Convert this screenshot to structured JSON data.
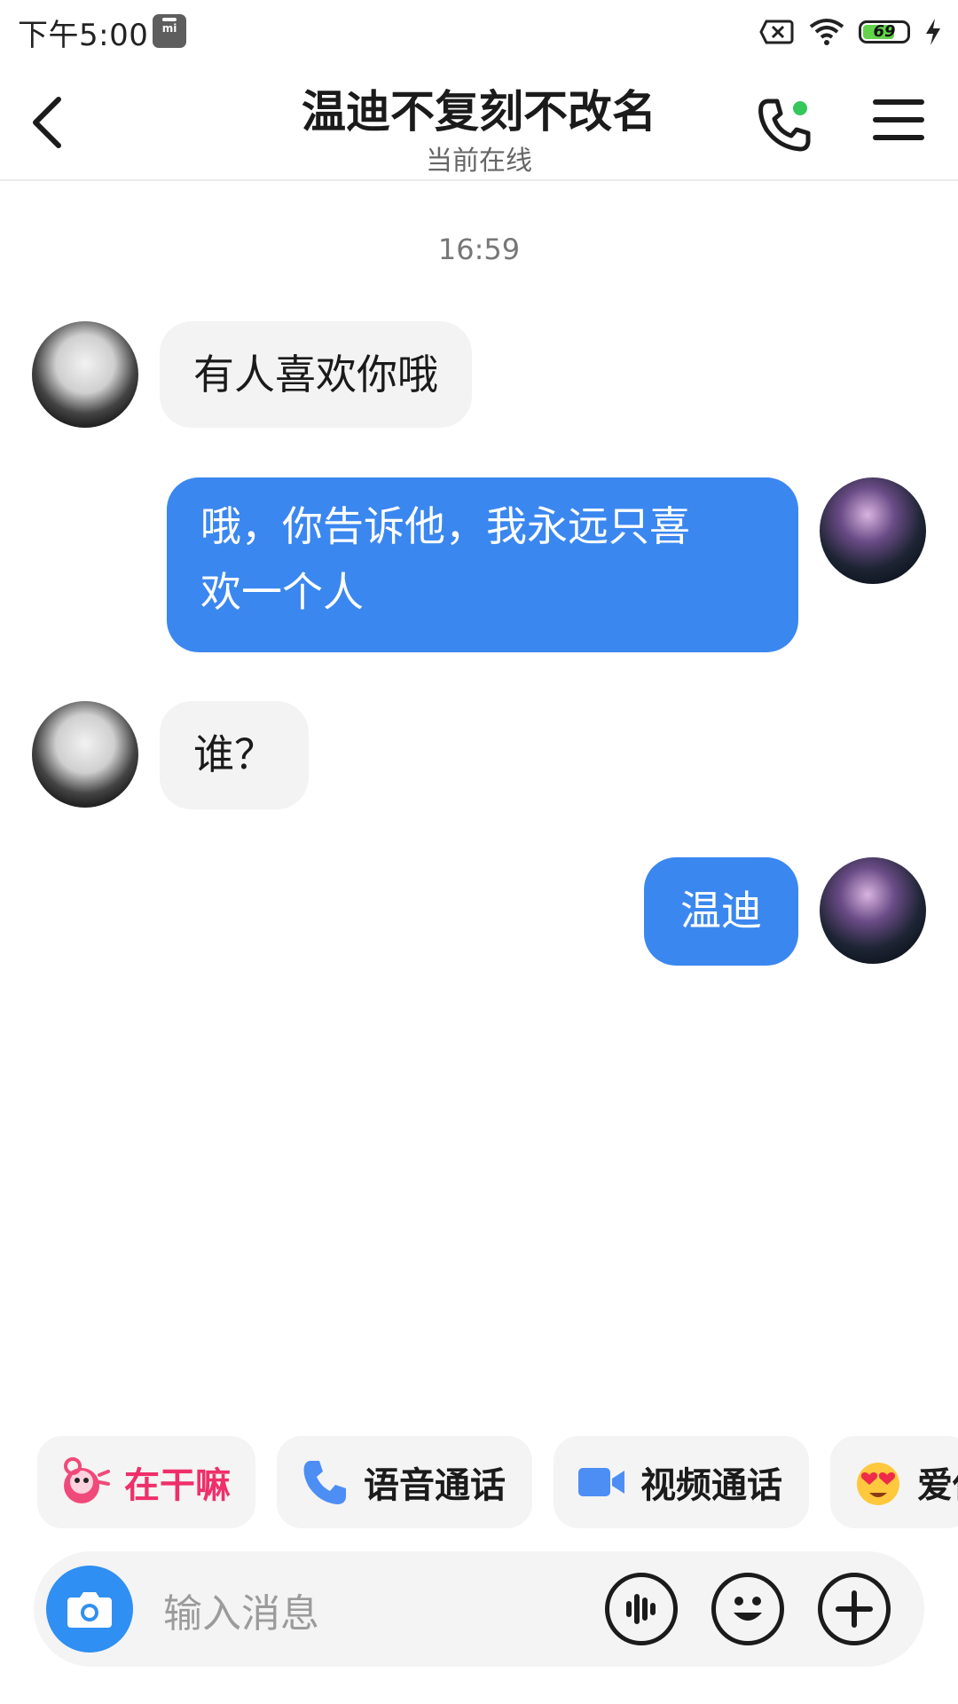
{
  "status_bar": {
    "time": "下午5:00",
    "battery_level": "69",
    "icons": [
      "mi-app-icon",
      "sim-off-icon",
      "wifi-icon",
      "battery-icon",
      "charging-icon"
    ]
  },
  "header": {
    "title": "温迪不复刻不改名",
    "subtitle": "当前在线",
    "icons": [
      "back-icon",
      "phone-call-icon",
      "menu-icon"
    ]
  },
  "chat": {
    "time_separator": "16:59",
    "messages": [
      {
        "side": "left",
        "text": "有人喜欢你哦"
      },
      {
        "side": "right",
        "line1": "哦，你告诉他，我永远只喜",
        "line2": "欢一个人"
      },
      {
        "side": "left",
        "text": "谁？"
      },
      {
        "side": "right",
        "text": "温迪"
      }
    ]
  },
  "quick_actions": [
    {
      "label": "在干嘛",
      "icon": "waving-character-icon"
    },
    {
      "label": "语音通话",
      "icon": "phone-icon"
    },
    {
      "label": "视频通话",
      "icon": "video-camera-icon"
    },
    {
      "label": "爱你",
      "icon": "heart-eyes-emoji-icon"
    }
  ],
  "input": {
    "placeholder": "输入消息",
    "icons": [
      "camera-icon",
      "voice-icon",
      "emoji-icon",
      "plus-icon"
    ]
  },
  "colors": {
    "outgoing_bubble": "#3b87f0",
    "incoming_bubble": "#f3f3f3",
    "online_dot": "#35c759",
    "camera_button": "#2f8ff2",
    "quick_action_pink": "#ef2f6a"
  }
}
